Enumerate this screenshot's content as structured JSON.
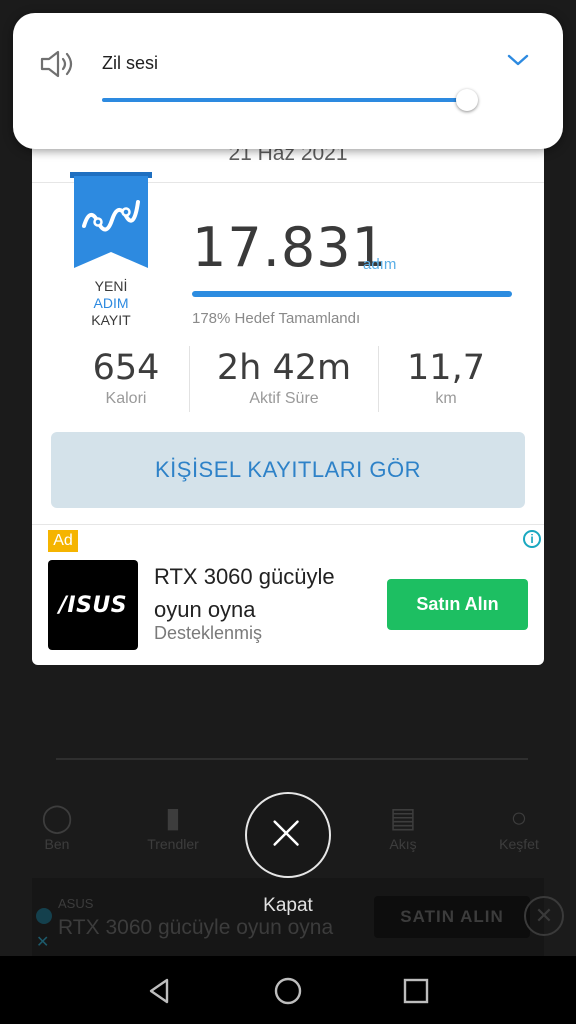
{
  "volume_panel": {
    "label": "Zil sesi",
    "level_percent": 96
  },
  "card": {
    "date": "21 Haz 2021",
    "badge": {
      "line1": "YENİ",
      "line2": "ADIM",
      "line3": "KAYIT"
    },
    "steps": "17.831",
    "steps_unit": "adım",
    "goal_text": "178% Hedef Tamamlandı",
    "goal_percent": 178,
    "stats": [
      {
        "value": "654",
        "label": "Kalori"
      },
      {
        "value": "2h 42m",
        "label": "Aktif Süre"
      },
      {
        "value": "11,7",
        "label": "km"
      }
    ],
    "records_button": "KİŞİSEL KAYITLARI GÖR"
  },
  "ad": {
    "badge": "Ad",
    "logo_text": "/ISUS",
    "title": "RTX 3060 gücüyle oyun oyna",
    "sponsored": "Desteklenmiş",
    "cta": "Satın Alın"
  },
  "close": {
    "label": "Kapat"
  },
  "background": {
    "nav": [
      "Ben",
      "Trendler",
      "Akış",
      "Keşfet"
    ],
    "ad_brand": "ASUS",
    "ad_text": "RTX 3060 gücüyle oyun oyna",
    "ad_cta": "SATIN ALIN"
  },
  "colors": {
    "accent": "#2d8ae0",
    "cta_green": "#1dbf62",
    "ad_badge": "#f5b400",
    "records_bg": "#d4e2ea"
  },
  "icons": [
    "speaker-icon",
    "chevron-down-icon",
    "ribbon-badge-icon",
    "info-icon",
    "close-icon",
    "back-icon",
    "home-icon",
    "recents-icon"
  ]
}
